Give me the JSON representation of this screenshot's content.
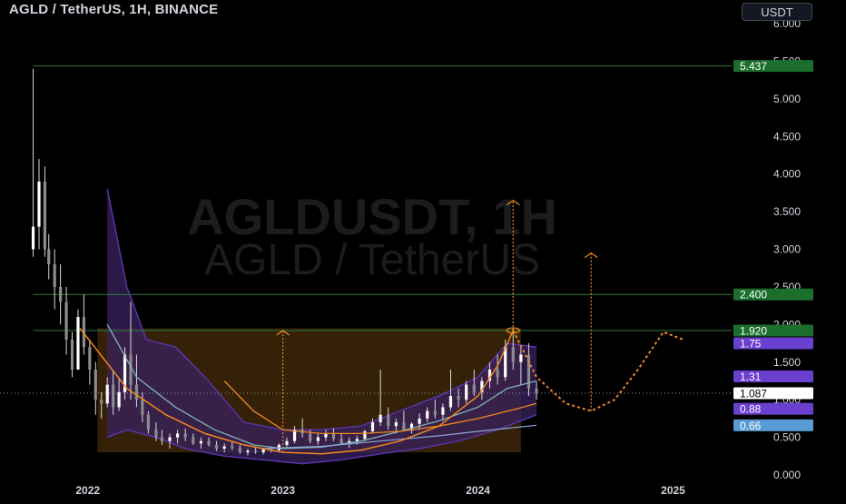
{
  "header": {
    "title": "AGLD / TetherUS, 1H, BINANCE",
    "currency_button": "USDT"
  },
  "watermark": {
    "line1": "AGLDUSDT, 1H",
    "line2": "AGLD / TetherUS"
  },
  "colors": {
    "background": "#000000",
    "text": "#d1d4dc",
    "green_tag": "#1b6e2c",
    "purple_tag": "#6b3fcf",
    "blue_tag": "#5b9bd5",
    "orange": "#f0881e",
    "cloud_purple": "#3a2160",
    "box_orange": "#3d2708"
  },
  "chart_data": {
    "type": "candlestick",
    "symbol": "AGLDUSDT",
    "interval": "1H",
    "exchange": "BINANCE",
    "x_axis": {
      "ticks": [
        "2022",
        "2023",
        "2024",
        "2025"
      ],
      "range": [
        2021.55,
        2025.3
      ]
    },
    "y_axis": {
      "ticks": [
        "0.000",
        "0.500",
        "1.000",
        "1.500",
        "2.000",
        "2.500",
        "3.000",
        "3.500",
        "4.000",
        "4.500",
        "5.000",
        "5.500",
        "6.000"
      ],
      "range": [
        0,
        6.0
      ]
    },
    "price_tags": [
      {
        "label": "5.437",
        "value": 5.437,
        "style": "green"
      },
      {
        "label": "2.400",
        "value": 2.4,
        "style": "green"
      },
      {
        "label": "1.920",
        "value": 1.92,
        "style": "green"
      },
      {
        "label": "1.75",
        "value": 1.75,
        "style": "purple"
      },
      {
        "label": "1.31",
        "value": 1.31,
        "style": "purple"
      },
      {
        "label": "1.087",
        "value": 1.087,
        "style": "white"
      },
      {
        "label": "0.88",
        "value": 0.88,
        "style": "purple"
      },
      {
        "label": "0.66",
        "value": 0.66,
        "style": "blue"
      }
    ],
    "horizontal_levels": [
      5.437,
      2.4,
      1.92
    ],
    "current_price": 1.087,
    "range_box": {
      "x_start": 2022.05,
      "x_end": 2024.22,
      "y_low": 0.3,
      "y_high": 1.95
    },
    "vertical_targets": [
      {
        "x": 2023.0,
        "from": 0.3,
        "to": 1.92
      },
      {
        "x": 2024.18,
        "from": 1.92,
        "to": 3.65
      },
      {
        "x": 2024.58,
        "from": 0.85,
        "to": 2.95
      }
    ],
    "projected_path": [
      [
        2024.18,
        1.92
      ],
      [
        2024.3,
        1.3
      ],
      [
        2024.45,
        0.95
      ],
      [
        2024.58,
        0.85
      ],
      [
        2024.7,
        1.0
      ],
      [
        2024.82,
        1.4
      ],
      [
        2024.95,
        1.9
      ],
      [
        2025.05,
        1.8
      ]
    ],
    "orange_ma": [
      [
        2021.96,
        1.95
      ],
      [
        2022.2,
        1.15
      ],
      [
        2022.4,
        0.8
      ],
      [
        2022.6,
        0.55
      ],
      [
        2022.8,
        0.4
      ],
      [
        2023.0,
        0.3
      ],
      [
        2023.2,
        0.28
      ],
      [
        2023.4,
        0.33
      ],
      [
        2023.6,
        0.45
      ],
      [
        2023.8,
        0.65
      ],
      [
        2024.0,
        1.05
      ],
      [
        2024.1,
        1.45
      ],
      [
        2024.18,
        1.92
      ]
    ],
    "orange_ma2": [
      [
        2022.7,
        1.25
      ],
      [
        2022.85,
        0.85
      ],
      [
        2023.0,
        0.6
      ],
      [
        2023.2,
        0.55
      ],
      [
        2023.4,
        0.55
      ],
      [
        2023.6,
        0.58
      ],
      [
        2023.8,
        0.65
      ],
      [
        2024.0,
        0.75
      ],
      [
        2024.2,
        0.88
      ],
      [
        2024.3,
        0.95
      ]
    ],
    "teal_ma": [
      [
        2022.1,
        2.0
      ],
      [
        2022.25,
        1.3
      ],
      [
        2022.45,
        0.9
      ],
      [
        2022.65,
        0.6
      ],
      [
        2022.85,
        0.4
      ],
      [
        2023.0,
        0.35
      ],
      [
        2023.2,
        0.37
      ],
      [
        2023.4,
        0.45
      ],
      [
        2023.6,
        0.58
      ],
      [
        2023.8,
        0.72
      ],
      [
        2024.0,
        0.9
      ],
      [
        2024.15,
        1.15
      ],
      [
        2024.3,
        1.25
      ]
    ],
    "blue_ma": [
      [
        2022.9,
        0.35
      ],
      [
        2023.2,
        0.38
      ],
      [
        2023.5,
        0.45
      ],
      [
        2023.8,
        0.52
      ],
      [
        2024.0,
        0.58
      ],
      [
        2024.15,
        0.62
      ],
      [
        2024.3,
        0.66
      ]
    ],
    "cloud_upper": [
      [
        2022.1,
        3.8
      ],
      [
        2022.2,
        2.5
      ],
      [
        2022.3,
        1.8
      ],
      [
        2022.45,
        1.7
      ],
      [
        2022.6,
        1.3
      ],
      [
        2022.8,
        0.7
      ],
      [
        2023.0,
        0.6
      ],
      [
        2023.2,
        0.6
      ],
      [
        2023.4,
        0.65
      ],
      [
        2023.6,
        0.85
      ],
      [
        2023.8,
        1.05
      ],
      [
        2024.0,
        1.3
      ],
      [
        2024.15,
        1.75
      ],
      [
        2024.3,
        1.7
      ]
    ],
    "cloud_lower": [
      [
        2022.1,
        0.5
      ],
      [
        2022.2,
        0.6
      ],
      [
        2022.35,
        0.5
      ],
      [
        2022.5,
        0.35
      ],
      [
        2022.7,
        0.25
      ],
      [
        2022.9,
        0.2
      ],
      [
        2023.1,
        0.15
      ],
      [
        2023.3,
        0.2
      ],
      [
        2023.5,
        0.28
      ],
      [
        2023.7,
        0.35
      ],
      [
        2023.9,
        0.45
      ],
      [
        2024.1,
        0.6
      ],
      [
        2024.3,
        0.8
      ]
    ],
    "candles": [
      [
        2021.72,
        3.0,
        5.4,
        2.9,
        3.3
      ],
      [
        2021.75,
        3.3,
        4.2,
        3.0,
        3.9
      ],
      [
        2021.78,
        3.9,
        4.1,
        2.9,
        3.0
      ],
      [
        2021.8,
        3.0,
        3.2,
        2.6,
        2.8
      ],
      [
        2021.83,
        2.8,
        3.0,
        2.2,
        2.5
      ],
      [
        2021.86,
        2.5,
        2.8,
        2.0,
        2.3
      ],
      [
        2021.89,
        2.3,
        2.5,
        1.6,
        1.8
      ],
      [
        2021.92,
        1.8,
        1.9,
        1.3,
        1.4
      ],
      [
        2021.95,
        1.4,
        2.2,
        1.4,
        2.1
      ],
      [
        2021.98,
        2.1,
        2.4,
        1.6,
        1.7
      ],
      [
        2022.01,
        1.7,
        1.8,
        1.2,
        1.4
      ],
      [
        2022.04,
        1.4,
        1.5,
        0.8,
        1.0
      ],
      [
        2022.07,
        1.0,
        1.1,
        0.75,
        0.95
      ],
      [
        2022.1,
        0.95,
        1.3,
        0.9,
        1.2
      ],
      [
        2022.13,
        1.2,
        1.4,
        0.8,
        0.9
      ],
      [
        2022.16,
        0.9,
        1.3,
        0.85,
        1.1
      ],
      [
        2022.19,
        1.1,
        1.7,
        1.0,
        1.6
      ],
      [
        2022.22,
        1.6,
        2.3,
        1.0,
        1.2
      ],
      [
        2022.25,
        1.2,
        1.6,
        0.9,
        1.0
      ],
      [
        2022.28,
        1.0,
        1.1,
        0.7,
        0.8
      ],
      [
        2022.31,
        0.8,
        0.85,
        0.55,
        0.6
      ],
      [
        2022.35,
        0.6,
        0.7,
        0.45,
        0.5
      ],
      [
        2022.38,
        0.5,
        0.6,
        0.4,
        0.45
      ],
      [
        2022.42,
        0.45,
        0.55,
        0.35,
        0.5
      ],
      [
        2022.46,
        0.5,
        0.6,
        0.42,
        0.55
      ],
      [
        2022.5,
        0.55,
        0.62,
        0.45,
        0.5
      ],
      [
        2022.54,
        0.5,
        0.55,
        0.4,
        0.42
      ],
      [
        2022.58,
        0.42,
        0.5,
        0.35,
        0.45
      ],
      [
        2022.62,
        0.45,
        0.5,
        0.38,
        0.4
      ],
      [
        2022.66,
        0.4,
        0.45,
        0.32,
        0.35
      ],
      [
        2022.7,
        0.35,
        0.42,
        0.3,
        0.38
      ],
      [
        2022.74,
        0.38,
        0.45,
        0.33,
        0.36
      ],
      [
        2022.78,
        0.36,
        0.4,
        0.28,
        0.3
      ],
      [
        2022.82,
        0.3,
        0.35,
        0.26,
        0.32
      ],
      [
        2022.86,
        0.32,
        0.38,
        0.28,
        0.3
      ],
      [
        2022.9,
        0.3,
        0.36,
        0.27,
        0.34
      ],
      [
        2022.94,
        0.34,
        0.38,
        0.3,
        0.33
      ],
      [
        2022.98,
        0.33,
        0.42,
        0.3,
        0.4
      ],
      [
        2023.02,
        0.4,
        0.5,
        0.35,
        0.45
      ],
      [
        2023.06,
        0.45,
        0.65,
        0.42,
        0.6
      ],
      [
        2023.1,
        0.6,
        0.75,
        0.5,
        0.55
      ],
      [
        2023.14,
        0.55,
        0.6,
        0.42,
        0.45
      ],
      [
        2023.18,
        0.45,
        0.55,
        0.4,
        0.5
      ],
      [
        2023.22,
        0.5,
        0.6,
        0.45,
        0.55
      ],
      [
        2023.26,
        0.55,
        0.62,
        0.45,
        0.48
      ],
      [
        2023.3,
        0.48,
        0.55,
        0.4,
        0.42
      ],
      [
        2023.34,
        0.42,
        0.5,
        0.36,
        0.45
      ],
      [
        2023.38,
        0.45,
        0.52,
        0.4,
        0.48
      ],
      [
        2023.42,
        0.48,
        0.6,
        0.45,
        0.58
      ],
      [
        2023.46,
        0.58,
        0.75,
        0.55,
        0.7
      ],
      [
        2023.5,
        0.7,
        1.4,
        0.65,
        0.8
      ],
      [
        2023.54,
        0.8,
        0.9,
        0.6,
        0.65
      ],
      [
        2023.58,
        0.65,
        0.75,
        0.55,
        0.7
      ],
      [
        2023.62,
        0.7,
        0.85,
        0.6,
        0.6
      ],
      [
        2023.66,
        0.6,
        0.7,
        0.55,
        0.68
      ],
      [
        2023.7,
        0.68,
        0.82,
        0.6,
        0.75
      ],
      [
        2023.74,
        0.75,
        0.9,
        0.7,
        0.85
      ],
      [
        2023.78,
        0.85,
        1.0,
        0.75,
        0.8
      ],
      [
        2023.82,
        0.8,
        0.95,
        0.72,
        0.9
      ],
      [
        2023.86,
        0.9,
        1.4,
        0.85,
        1.05
      ],
      [
        2023.9,
        1.05,
        1.15,
        0.9,
        1.0
      ],
      [
        2023.94,
        1.0,
        1.25,
        0.95,
        1.2
      ],
      [
        2023.98,
        1.2,
        1.4,
        1.05,
        1.1
      ],
      [
        2024.02,
        1.1,
        1.3,
        1.0,
        1.25
      ],
      [
        2024.06,
        1.25,
        1.5,
        1.15,
        1.4
      ],
      [
        2024.1,
        1.4,
        1.6,
        1.2,
        1.3
      ],
      [
        2024.14,
        1.3,
        1.8,
        1.25,
        1.7
      ],
      [
        2024.18,
        1.7,
        1.95,
        1.4,
        1.5
      ],
      [
        2024.22,
        1.5,
        1.7,
        1.2,
        1.6
      ],
      [
        2024.26,
        1.6,
        1.75,
        1.05,
        1.15
      ],
      [
        2024.3,
        1.15,
        1.25,
        1.0,
        1.087
      ]
    ]
  }
}
